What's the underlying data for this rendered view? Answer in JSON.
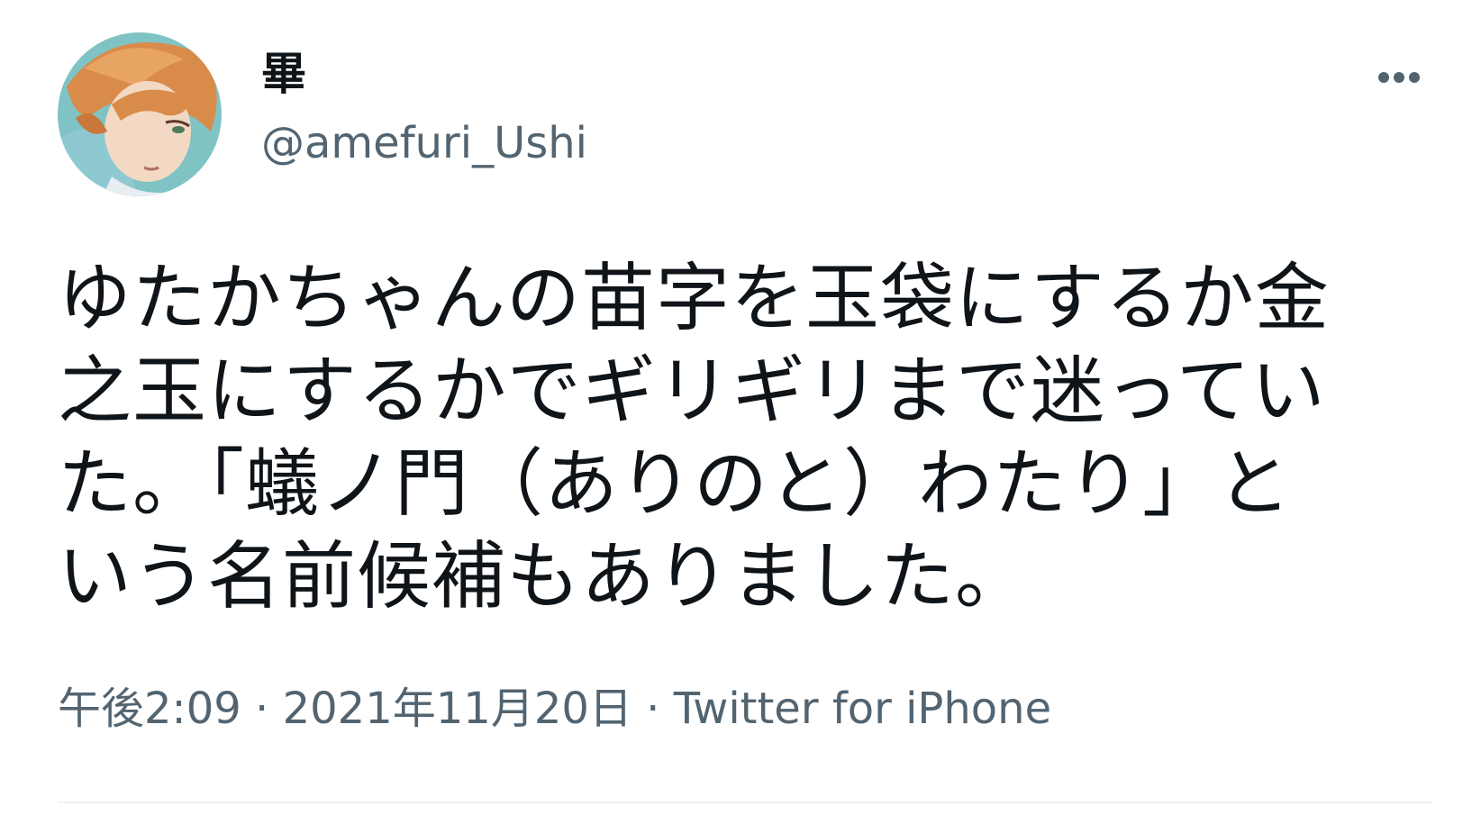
{
  "tweet": {
    "author": {
      "display_name": "畢",
      "handle": "@amefuri_Ushi"
    },
    "text": "ゆたかちゃんの苗字を玉袋にするか金\n之玉にするかでギリギリまで迷ってい\nた。「蟻ノ門（ありのと）わたり」と\nいう名前候補もありました。",
    "time": "午後2:09",
    "date": "2021年11月20日",
    "source": "Twitter for iPhone",
    "separator": " · "
  },
  "icons": {
    "more": "more-horizontal-icon",
    "avatar": "avatar-illustration"
  },
  "colors": {
    "text_primary": "#0f1419",
    "text_secondary": "#536471",
    "divider": "#eff3f4"
  }
}
